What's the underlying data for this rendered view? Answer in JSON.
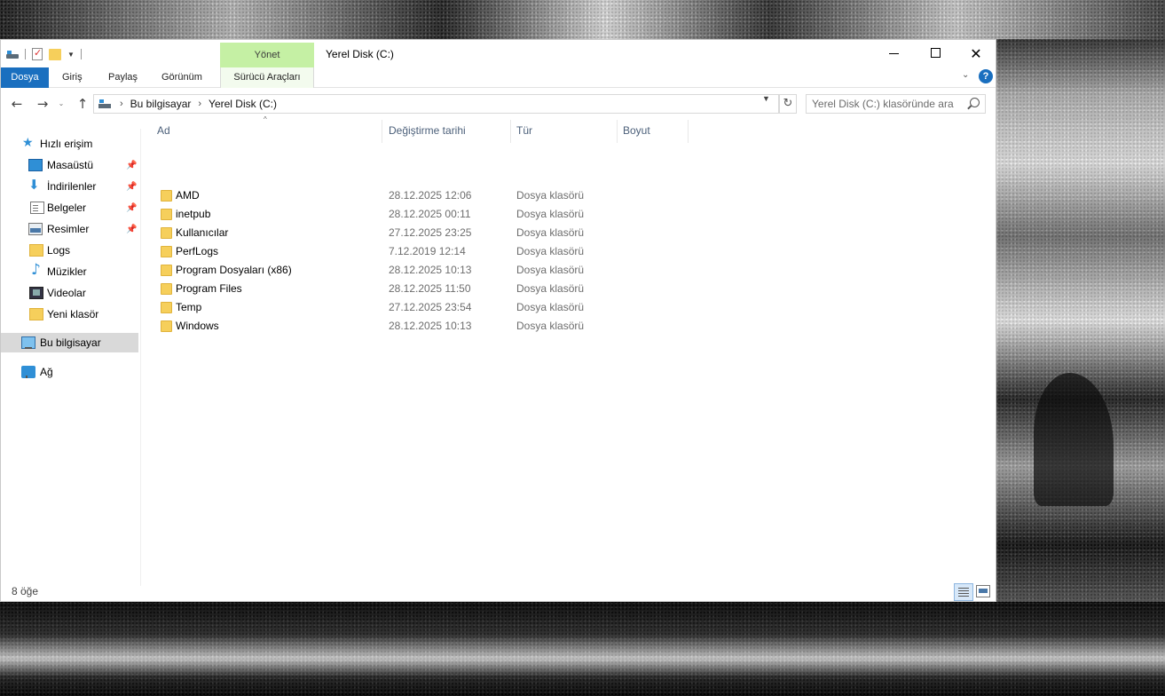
{
  "window": {
    "title": "Yerel Disk (C:)",
    "contextual_group": "Yönet"
  },
  "ribbon": {
    "tabs": [
      {
        "label": "Dosya"
      },
      {
        "label": "Giriş"
      },
      {
        "label": "Paylaş"
      },
      {
        "label": "Görünüm"
      },
      {
        "label": "Sürücü Araçları"
      }
    ],
    "help_label": "?"
  },
  "address": {
    "crumbs": [
      "Bu bilgisayar",
      "Yerel Disk (C:)"
    ],
    "search_placeholder": "Yerel Disk (C:) klasöründe ara"
  },
  "navpane": {
    "quick_access": "Hızlı erişim",
    "items": [
      {
        "label": "Masaüstü",
        "icon": "desktop-icon",
        "pinned": true
      },
      {
        "label": "İndirilenler",
        "icon": "downloads-icon",
        "pinned": true
      },
      {
        "label": "Belgeler",
        "icon": "documents-icon",
        "pinned": true
      },
      {
        "label": "Resimler",
        "icon": "pictures-icon",
        "pinned": true
      },
      {
        "label": "Logs",
        "icon": "folder-icon",
        "pinned": false
      },
      {
        "label": "Müzikler",
        "icon": "music-icon",
        "pinned": false
      },
      {
        "label": "Videolar",
        "icon": "videos-icon",
        "pinned": false
      },
      {
        "label": "Yeni klasör",
        "icon": "folder-icon",
        "pinned": false
      }
    ],
    "this_pc": "Bu bilgisayar",
    "network": "Ağ"
  },
  "filelist": {
    "columns": [
      "Ad",
      "Değiştirme tarihi",
      "Tür",
      "Boyut"
    ],
    "rows": [
      {
        "name": "AMD",
        "date": "28.12.2025 12:06",
        "type": "Dosya klasörü"
      },
      {
        "name": "inetpub",
        "date": "28.12.2025 00:11",
        "type": "Dosya klasörü"
      },
      {
        "name": "Kullanıcılar",
        "date": "27.12.2025 23:25",
        "type": "Dosya klasörü"
      },
      {
        "name": "PerfLogs",
        "date": "7.12.2019 12:14",
        "type": "Dosya klasörü"
      },
      {
        "name": "Program Dosyaları (x86)",
        "date": "28.12.2025 10:13",
        "type": "Dosya klasörü"
      },
      {
        "name": "Program Files",
        "date": "28.12.2025 11:50",
        "type": "Dosya klasörü"
      },
      {
        "name": "Temp",
        "date": "27.12.2025 23:54",
        "type": "Dosya klasörü"
      },
      {
        "name": "Windows",
        "date": "28.12.2025 10:13",
        "type": "Dosya klasörü"
      }
    ]
  },
  "status": {
    "item_count": "8 öğe"
  },
  "colors": {
    "accent": "#1a6fbf",
    "contextual_tab": "#c5f0a4",
    "folder": "#f6cf5b"
  }
}
